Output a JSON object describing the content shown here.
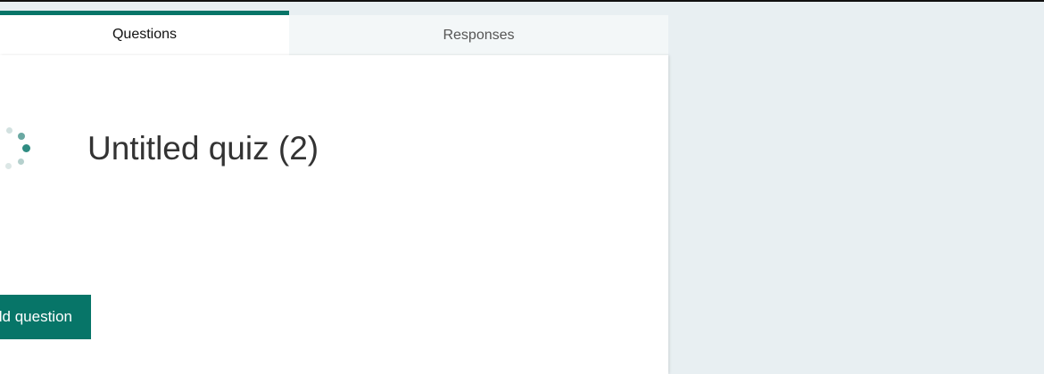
{
  "tabs": {
    "questions_label": "Questions",
    "responses_label": "Responses",
    "active": "Questions"
  },
  "form": {
    "title": "Untitled quiz (2)"
  },
  "actions": {
    "add_question_label": "Add question"
  },
  "loading": {
    "icon": "loading-spinner-icon"
  },
  "colors": {
    "accent": "#077568",
    "page_background": "#e8eff2",
    "panel_background": "#ffffff",
    "inactive_tab_background": "#f3f7f8"
  }
}
